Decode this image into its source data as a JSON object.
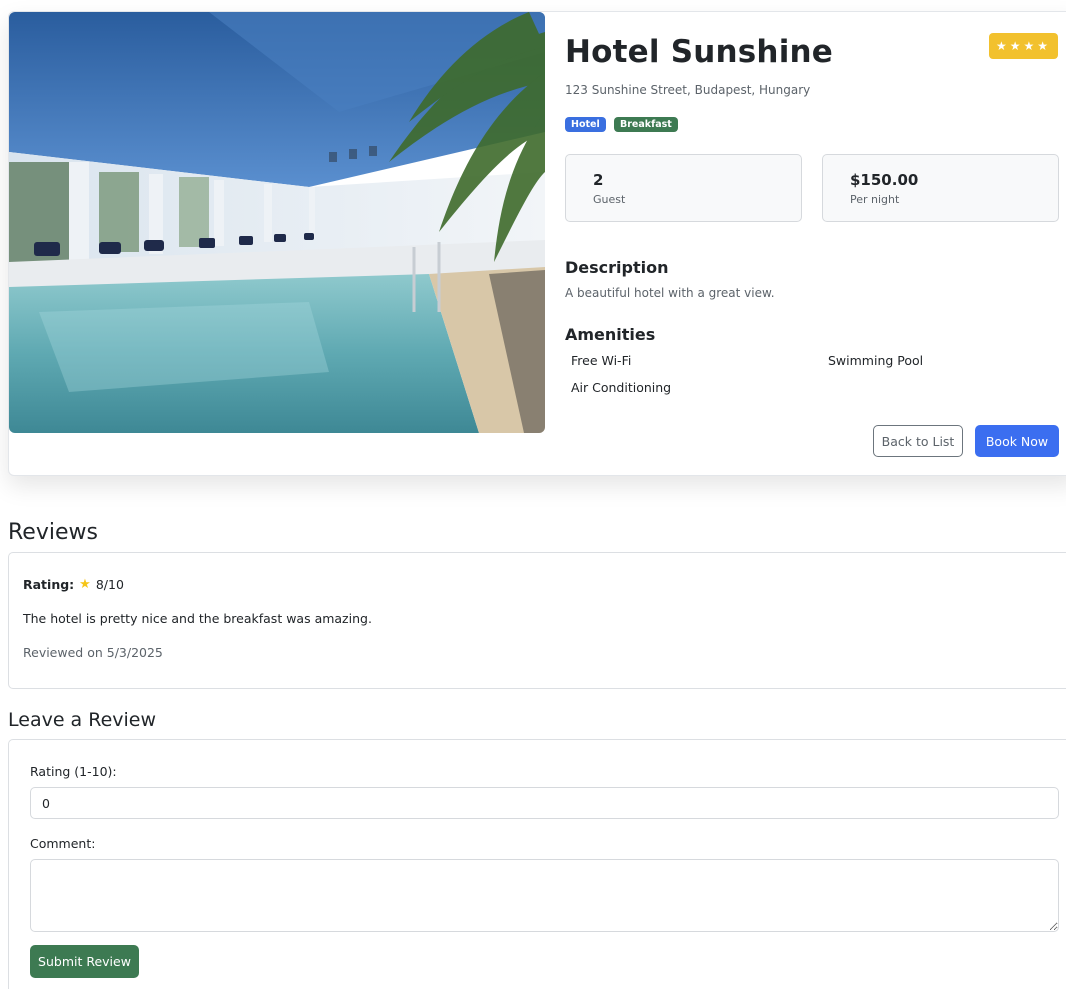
{
  "hotel": {
    "name": "Hotel Sunshine",
    "star_glyphs": "★★★★",
    "star_count": 4,
    "address": "123 Sunshine Street, Budapest, Hungary",
    "tags": [
      {
        "label": "Hotel",
        "color": "#3a6fe0"
      },
      {
        "label": "Breakfast",
        "color": "#3d7a52"
      }
    ],
    "guests": {
      "value": "2",
      "label": "Guest"
    },
    "price": {
      "value": "$150.00",
      "label": "Per night"
    },
    "description_heading": "Description",
    "description": "A beautiful hotel with a great view.",
    "amenities_heading": "Amenities",
    "amenities": [
      "Free Wi-Fi",
      "Swimming Pool",
      "Air Conditioning"
    ],
    "image_icon": "indoor-pool-photo"
  },
  "actions": {
    "back_label": "Back to List",
    "book_label": "Book Now"
  },
  "reviews": {
    "heading": "Reviews",
    "items": [
      {
        "rating_label": "Rating:",
        "rating_icon": "star-icon",
        "rating_value": "8/10",
        "comment": "The hotel is pretty nice and the breakfast was amazing.",
        "date": "Reviewed on 5/3/2025"
      }
    ]
  },
  "review_form": {
    "heading": "Leave a Review",
    "rating_label": "Rating (1-10):",
    "rating_value": "0",
    "comment_label": "Comment:",
    "comment_value": "",
    "submit_label": "Submit Review"
  },
  "colors": {
    "primary": "#3b6ef0",
    "success": "#3d7a52",
    "warning": "#f2c12e"
  }
}
